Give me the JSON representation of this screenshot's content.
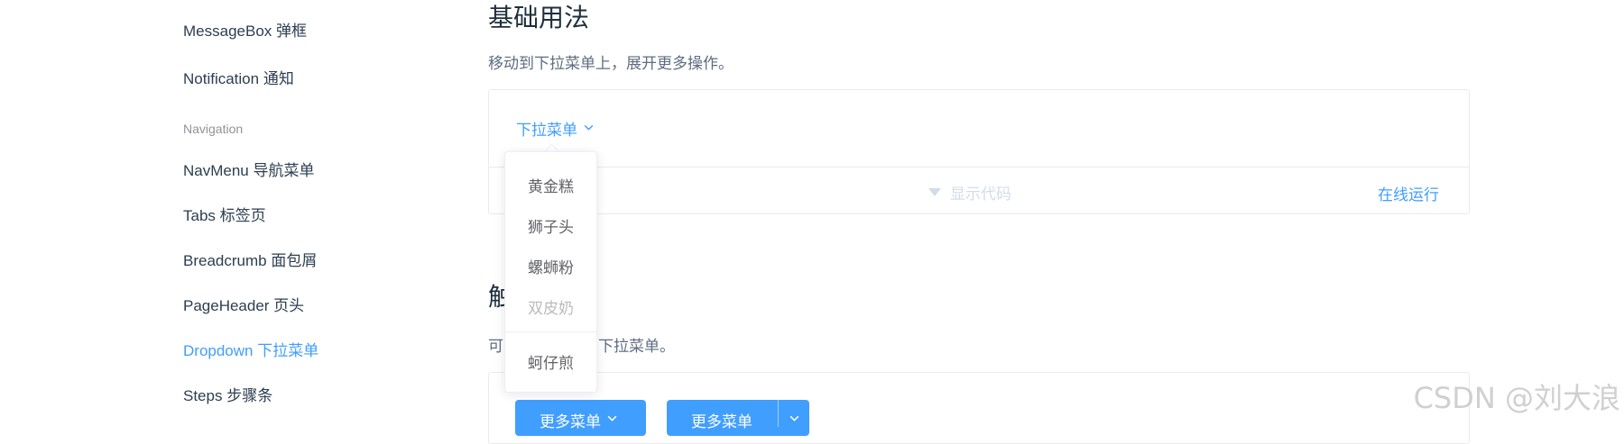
{
  "sidebar": {
    "items": [
      {
        "label": "MessageBox 弹框"
      },
      {
        "label": "Notification 通知"
      },
      {
        "group": "Navigation"
      },
      {
        "label": "NavMenu 导航菜单"
      },
      {
        "label": "Tabs 标签页"
      },
      {
        "label": "Breadcrumb 面包屑"
      },
      {
        "label": "PageHeader 页头"
      },
      {
        "label": "Dropdown 下拉菜单",
        "active": true
      },
      {
        "label": "Steps 步骤条"
      }
    ]
  },
  "main": {
    "section_title": "基础用法",
    "section_desc": "移动到下拉菜单上，展开更多操作。",
    "demo": {
      "trigger_label": "下拉菜单",
      "show_code": "显示代码",
      "run_online": "在线运行"
    },
    "dropdown": {
      "items": [
        {
          "label": "黄金糕"
        },
        {
          "label": "狮子头"
        },
        {
          "label": "螺蛳粉"
        },
        {
          "label": "双皮奶",
          "disabled": true
        },
        {
          "label": "蚵仔煎",
          "divided": true
        }
      ]
    },
    "section2": {
      "title_visible": "触",
      "desc_left": "可",
      "desc_right": "下拉菜单。",
      "button1": "更多菜单",
      "button2": "更多菜单"
    }
  },
  "watermark": "CSDN @刘大浪",
  "colors": {
    "accent": "#409eff",
    "text": "#2c3e50",
    "muted": "#909399",
    "disabled": "#bbbbbb"
  }
}
